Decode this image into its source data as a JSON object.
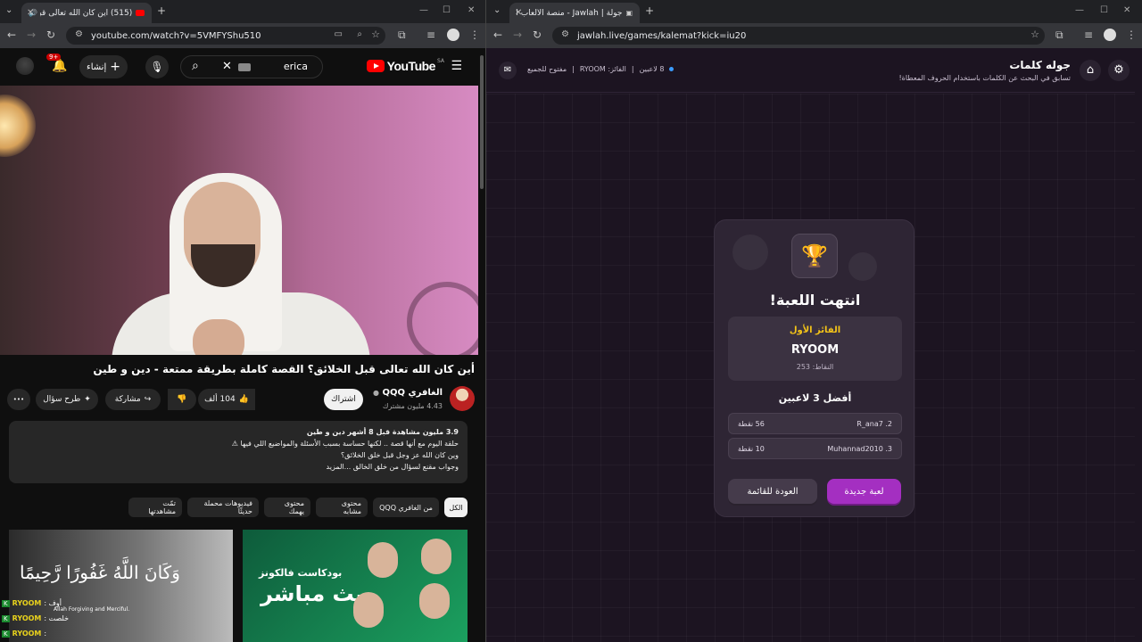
{
  "left_browser": {
    "tab_title": "(515) أين كان الله تعالى قبل ال",
    "url": "youtube.com/watch?v=5VMFYShu510",
    "youtube": {
      "logo": "YouTube",
      "region": "SA",
      "search_value": "erica",
      "create_label": "إنشاء",
      "notif_count": "9+",
      "video_title": "أين كان الله تعالى قبل الخلائق؟ القصة كاملة بطريقة ممتعة - دين و طين",
      "channel_name": "الغافري QQQ",
      "subscribers": "4.43 مليون مشترك",
      "subscribe_label": "اشتراك",
      "likes": "104 ألف",
      "share_label": "مشاركة",
      "ask_label": "طرح سؤال",
      "more_label": "•••",
      "description": {
        "views_line": "3.9 مليون مشاهدة  قبل 8 أشهر  دين و طين",
        "line1": "حلقة اليوم مع أنها قصة .. لكنها حساسة بسبب الأسئلة والمواضيع اللي فيها ⚠",
        "line2": "وين كان الله عز وجل قبل خلق الخلائق؟",
        "line3": "وجواب مقنع لسؤال من خلق الخالق ...المزيد"
      },
      "chips": [
        "الكل",
        "من الغافري QQQ",
        "محتوى مشابه",
        "محتوى يهمك",
        "فيديوهات محملة حديثًا",
        "تمّت مشاهدتها"
      ],
      "thumb1_text": "وَكَانَ اللَّهُ غَفُورًا رَّحِيمًا",
      "thumb1_sub": "Allah Forgiving and Merciful.",
      "thumb2_line1": "بودكاست فالكونز",
      "thumb2_line2": "بث مباشر",
      "chat": [
        {
          "user": "RYOOM",
          "text": ": أوف"
        },
        {
          "user": "RYOOM",
          "text": ": خلصت"
        },
        {
          "user": "RYOOM",
          "text": ":"
        }
      ]
    }
  },
  "right_browser": {
    "tab_title": "جولة | Jawlah - منصة الألعاب الا",
    "url": "jawlah.live/games/kalemat?kick=iu20",
    "header": {
      "title": "جوله كلمات",
      "subtitle": "تسابق في البحث عن الكلمات باستخدام الحروف المعطاة!",
      "players": "8 لاعبين",
      "winner_meta": "الفائز: RYOOM",
      "open": "مفتوح للجميع"
    },
    "card": {
      "title": "انتهت اللعبة!",
      "winner_label": "الفائز الأول",
      "winner_name": "RYOOM",
      "winner_points": "النقاط: 253",
      "top_label": "أفضل 3 لاعبين",
      "rows": [
        {
          "name": "2. R_ana7",
          "points": "56 نقطة"
        },
        {
          "name": "3. Muhannad2010",
          "points": "10 نقطة"
        }
      ],
      "new_game": "لعبة جديدة",
      "back": "العودة للقائمة"
    }
  },
  "colors": {
    "yt_bg": "#0f0f0f",
    "yt_red": "#ff0000",
    "jawlah_bg": "#1c1421",
    "jawlah_accent": "#a42fc1",
    "winner_gold": "#f5c518"
  }
}
